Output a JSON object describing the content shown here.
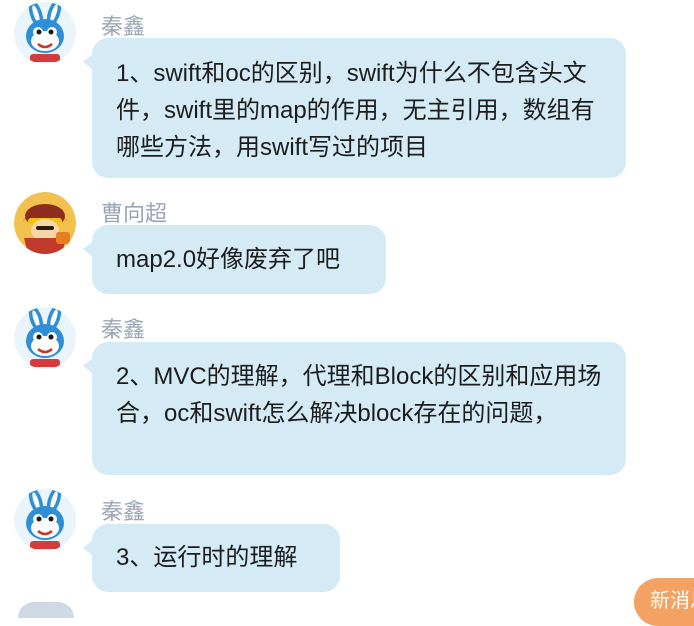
{
  "messages": [
    {
      "sender": "秦鑫",
      "avatar": "blue-bunny-avatar",
      "text": "1、swift和oc的区别，swift为什么不包含头文件，swift里的map的作用，无主引用，数组有哪些方法，用swift写过的项目"
    },
    {
      "sender": "曹向超",
      "avatar": "red-armored-warrior-avatar",
      "text": "map2.0好像废弃了吧"
    },
    {
      "sender": "秦鑫",
      "avatar": "blue-bunny-avatar",
      "text": "2、MVC的理解，代理和Block的区别和应用场合，oc和swift怎么解决block存在的问题，"
    },
    {
      "sender": "秦鑫",
      "avatar": "blue-bunny-avatar",
      "text": "3、运行时的理解"
    }
  ],
  "new_message_button": "新消息",
  "colors": {
    "bubble": "#d4ebf5",
    "sender": "#9aa5b8",
    "new_message": "#f4a263"
  }
}
